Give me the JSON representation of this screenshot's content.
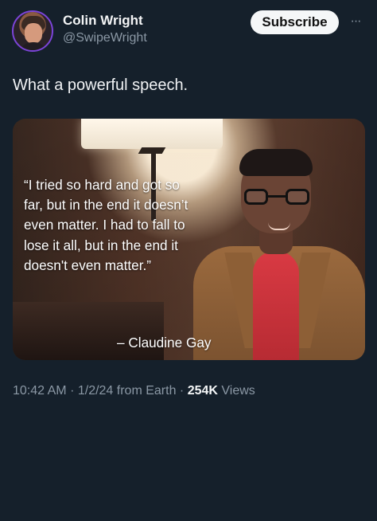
{
  "author": {
    "name": "Colin Wright",
    "handle": "@SwipeWright"
  },
  "actions": {
    "subscribe_label": "Subscribe",
    "more_label": "···"
  },
  "post": {
    "text": "What a powerful speech."
  },
  "media": {
    "quote": "“I tried so hard and got so\nfar, but in the end it doesn’t\neven matter. I had to fall to\nlose it all, but in the end it\ndoesn't even matter.”",
    "attribution": "– Claudine Gay"
  },
  "meta": {
    "time": "10:42 AM",
    "date": "1/2/24",
    "source": "from Earth",
    "views_count": "254K",
    "views_label": "Views"
  },
  "colors": {
    "background": "#15202b",
    "accent_button": "#f5f7f8",
    "muted_text": "#8b98a5"
  },
  "icons": {
    "avatar": "profile-avatar",
    "more": "more-icon"
  }
}
